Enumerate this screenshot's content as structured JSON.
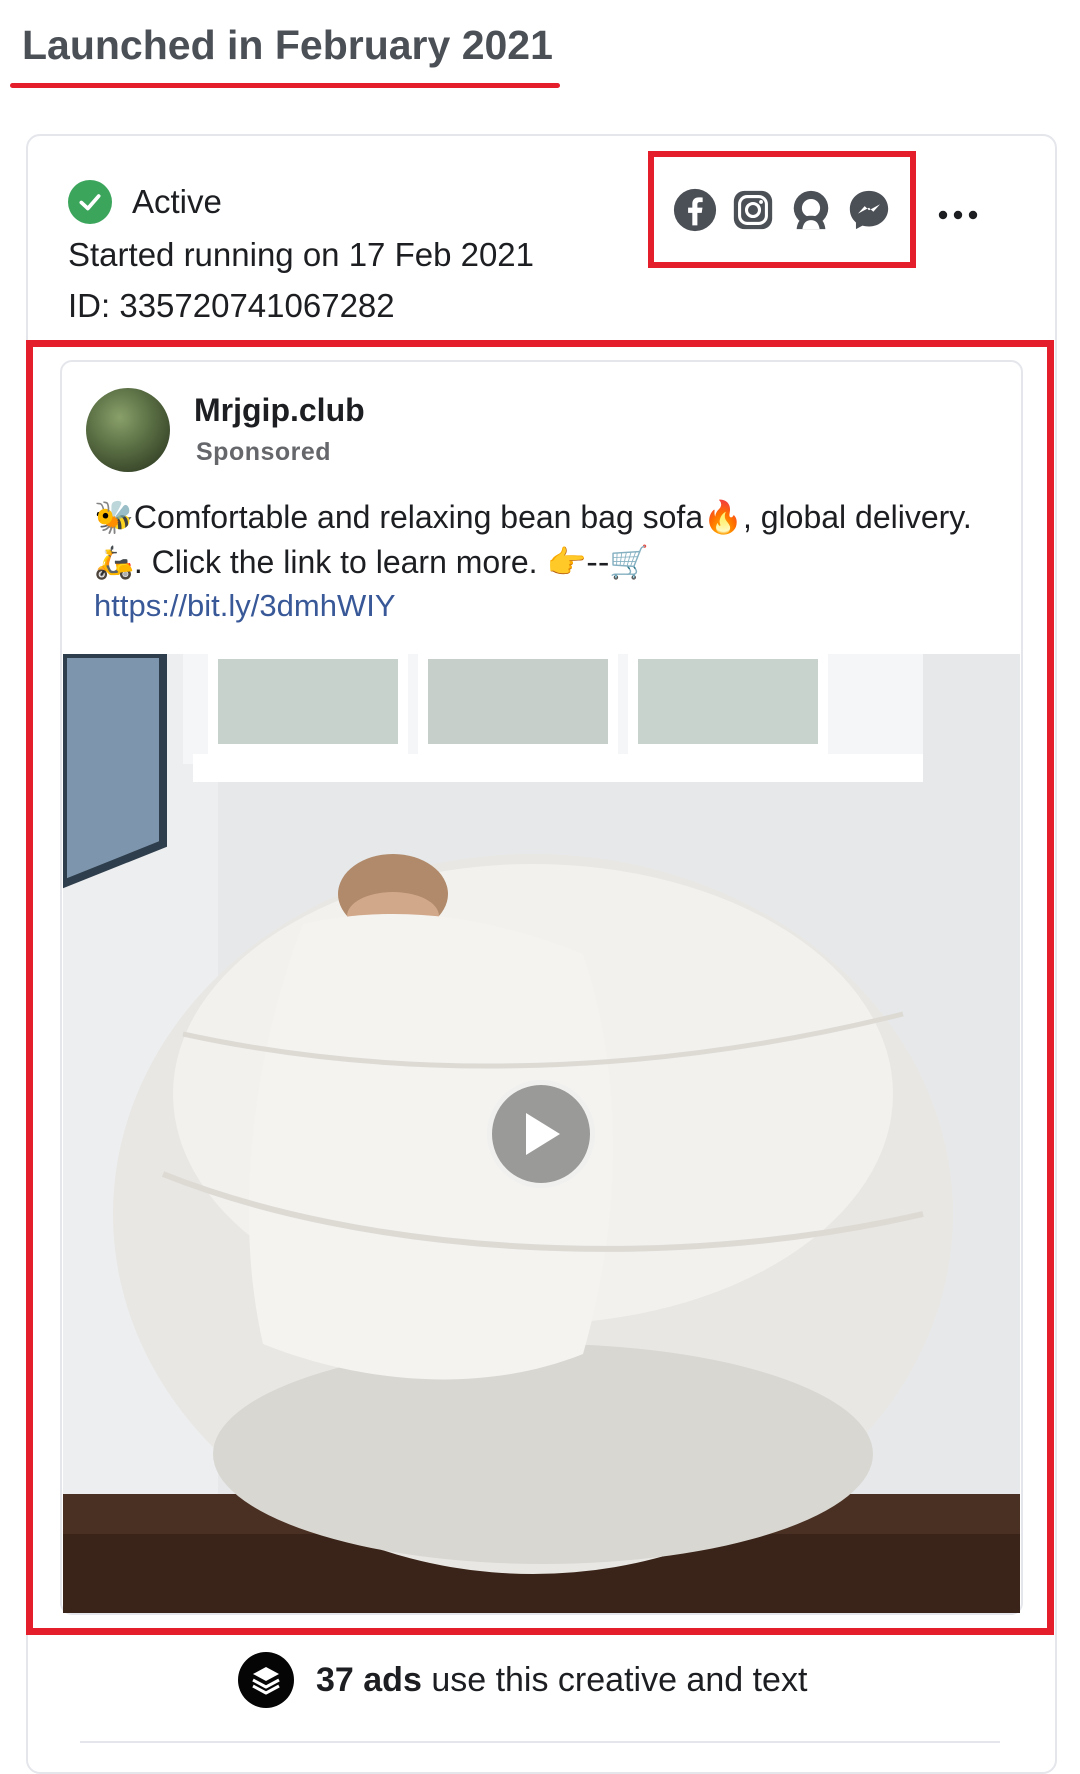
{
  "section_heading": "Launched in February 2021",
  "ad": {
    "status": "Active",
    "started_running": "Started running on 17 Feb 2021",
    "id_text": "ID: 335720741067282",
    "platforms": [
      "facebook-icon",
      "instagram-icon",
      "audience-network-icon",
      "messenger-icon"
    ],
    "more_label": "•••"
  },
  "post": {
    "page_name": "Mrjgip.club",
    "sponsored": "Sponsored",
    "body_part1": "Comfortable and relaxing bean bag sofa",
    "body_part2": ",  global delivery.",
    "body_part3": ". Click the link to learn more. ",
    "emoji_start": "🐝",
    "emoji_fire": "🔥",
    "emoji_delivery": "🛵",
    "emoji_end": "👉--🛒",
    "link": "https://bit.ly/3dmhWIY"
  },
  "footer": {
    "count": "37 ads",
    "text": "use this creative and text"
  },
  "colors": {
    "highlight": "#e41e2a",
    "active_green": "#3ba55c",
    "link_blue": "#385898",
    "icon_gray": "#4b4f56"
  }
}
